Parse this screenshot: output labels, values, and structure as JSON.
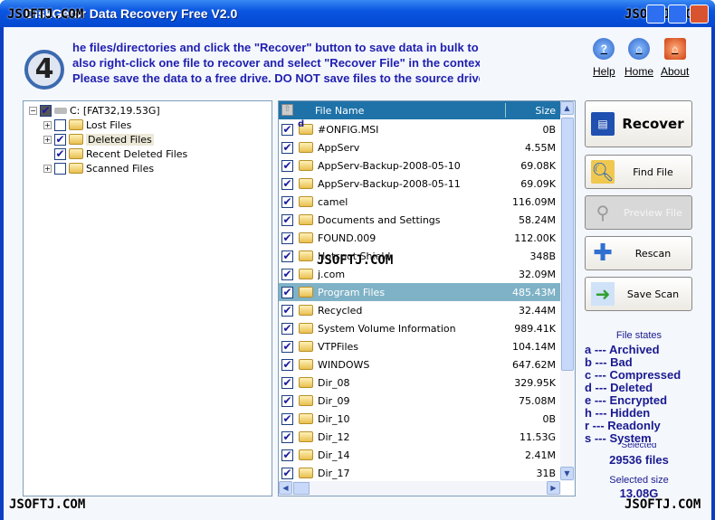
{
  "window": {
    "title": "DiskGetor Data Recovery Free V2.0",
    "watermark": "JSOFTJ.COM"
  },
  "step": "4",
  "instructions": [
    "he files/directories and click the \"Recover\" button to save data in bulk to",
    " also right-click one file to recover and select \"Recover File\" in the contex",
    "Please save the data to a free drive. DO NOT save files to the source drive"
  ],
  "top_links": [
    {
      "label": "Help",
      "icon": "help-icon"
    },
    {
      "label": "Home",
      "icon": "home-icon"
    },
    {
      "label": "About",
      "icon": "about-icon"
    }
  ],
  "tree": {
    "root": {
      "label": "C:  [FAT32,19.53G]",
      "checked": true
    },
    "children": [
      {
        "label": "Lost Files",
        "checked": false,
        "expandable": true
      },
      {
        "label": "Deleted Files",
        "checked": true,
        "expandable": true,
        "selected": true
      },
      {
        "label": "Recent Deleted Files",
        "checked": true,
        "expandable": false
      },
      {
        "label": "Scanned Files",
        "checked": false,
        "expandable": true
      }
    ]
  },
  "file_list": {
    "columns": {
      "name": "File Name",
      "size": "Size"
    },
    "rows": [
      {
        "name": "#ONFIG.MSI",
        "size": "0B",
        "state": "d"
      },
      {
        "name": "AppServ",
        "size": "4.55M"
      },
      {
        "name": "AppServ-Backup-2008-05-10",
        "size": "69.08K"
      },
      {
        "name": "AppServ-Backup-2008-05-11",
        "size": "69.09K"
      },
      {
        "name": "camel",
        "size": "116.09M"
      },
      {
        "name": "Documents and Settings",
        "size": "58.24M"
      },
      {
        "name": "FOUND.009",
        "size": "112.00K"
      },
      {
        "name": "Hotspot Shield",
        "size": "348B"
      },
      {
        "name": "j.com",
        "size": "32.09M"
      },
      {
        "name": "Program Files",
        "size": "485.43M",
        "selected": true
      },
      {
        "name": "Recycled",
        "size": "32.44M"
      },
      {
        "name": "System Volume Information",
        "size": "989.41K"
      },
      {
        "name": "VTPFiles",
        "size": "104.14M"
      },
      {
        "name": "WINDOWS",
        "size": "647.62M"
      },
      {
        "name": "Dir_08",
        "size": "329.95K"
      },
      {
        "name": "Dir_09",
        "size": "75.08M"
      },
      {
        "name": "Dir_10",
        "size": "0B"
      },
      {
        "name": "Dir_12",
        "size": "11.53G"
      },
      {
        "name": "Dir_14",
        "size": "2.41M"
      },
      {
        "name": "Dir_17",
        "size": "31B"
      }
    ]
  },
  "buttons": {
    "recover": "Recover",
    "find": "Find File",
    "preview": "Preview File",
    "rescan": "Rescan",
    "save_scan": "Save Scan"
  },
  "file_states": {
    "title": "File states",
    "items": [
      "a --- Archived",
      "b --- Bad",
      "c --- Compressed",
      "d --- Deleted",
      "e --- Encrypted",
      "h --- Hidden",
      "r --- Readonly",
      "s --- System"
    ]
  },
  "selected": {
    "label": "Selected",
    "value": "29536 files"
  },
  "selected_size": {
    "label": "Selected size",
    "value": "13.08G"
  }
}
